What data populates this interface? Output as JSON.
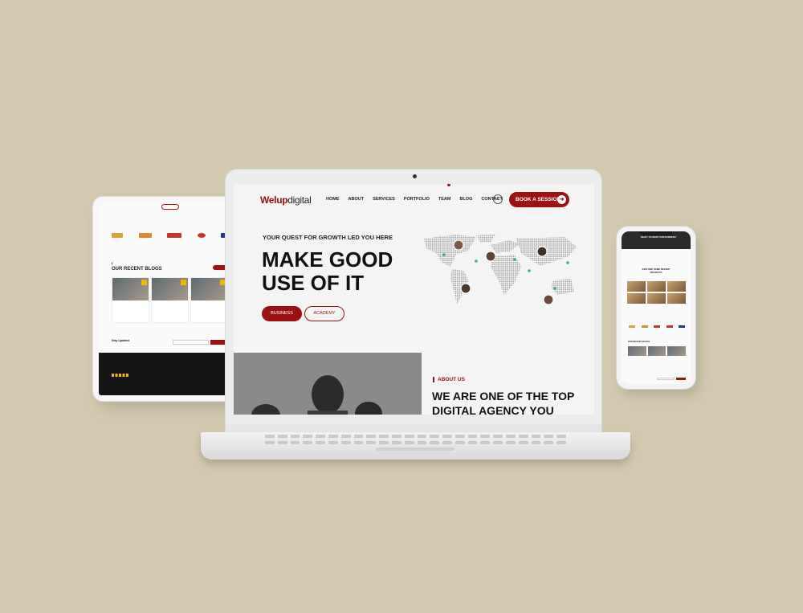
{
  "laptop": {
    "logo": {
      "part1": "Welup",
      "part2": "digital"
    },
    "nav": [
      "HOME",
      "ABOUT",
      "SERVICES",
      "PORTFOLIO",
      "TEAM",
      "BLOG",
      "CONTACT"
    ],
    "book_button": "BOOK A SESSION",
    "hero_tagline": "YOUR QUEST FOR GROWTH LED YOU HERE",
    "hero_title_line1": "MAKE GOOD",
    "hero_title_line2": "USE OF IT",
    "btn_business": "BUSINESS",
    "btn_academy": "ACADEMY",
    "about_tag": "ABOUT US",
    "about_title_line1": "WE ARE ONE OF THE TOP",
    "about_title_line2": "DIGITAL AGENCY YOU"
  },
  "tablet": {
    "section_title": "OUR RECENT BLOGS",
    "newsletter_label": "Stay Updated"
  },
  "phone": {
    "hero_text": "READY TO GROW YOUR BUSINESS?",
    "section_title": "EXPLORE SOME RECENT PROJECTS",
    "blog_title": "OUR RECENT BLOGS"
  },
  "colors": {
    "accent": "#9c1111",
    "background": "#d3c9ae",
    "star": "#f2b600"
  }
}
